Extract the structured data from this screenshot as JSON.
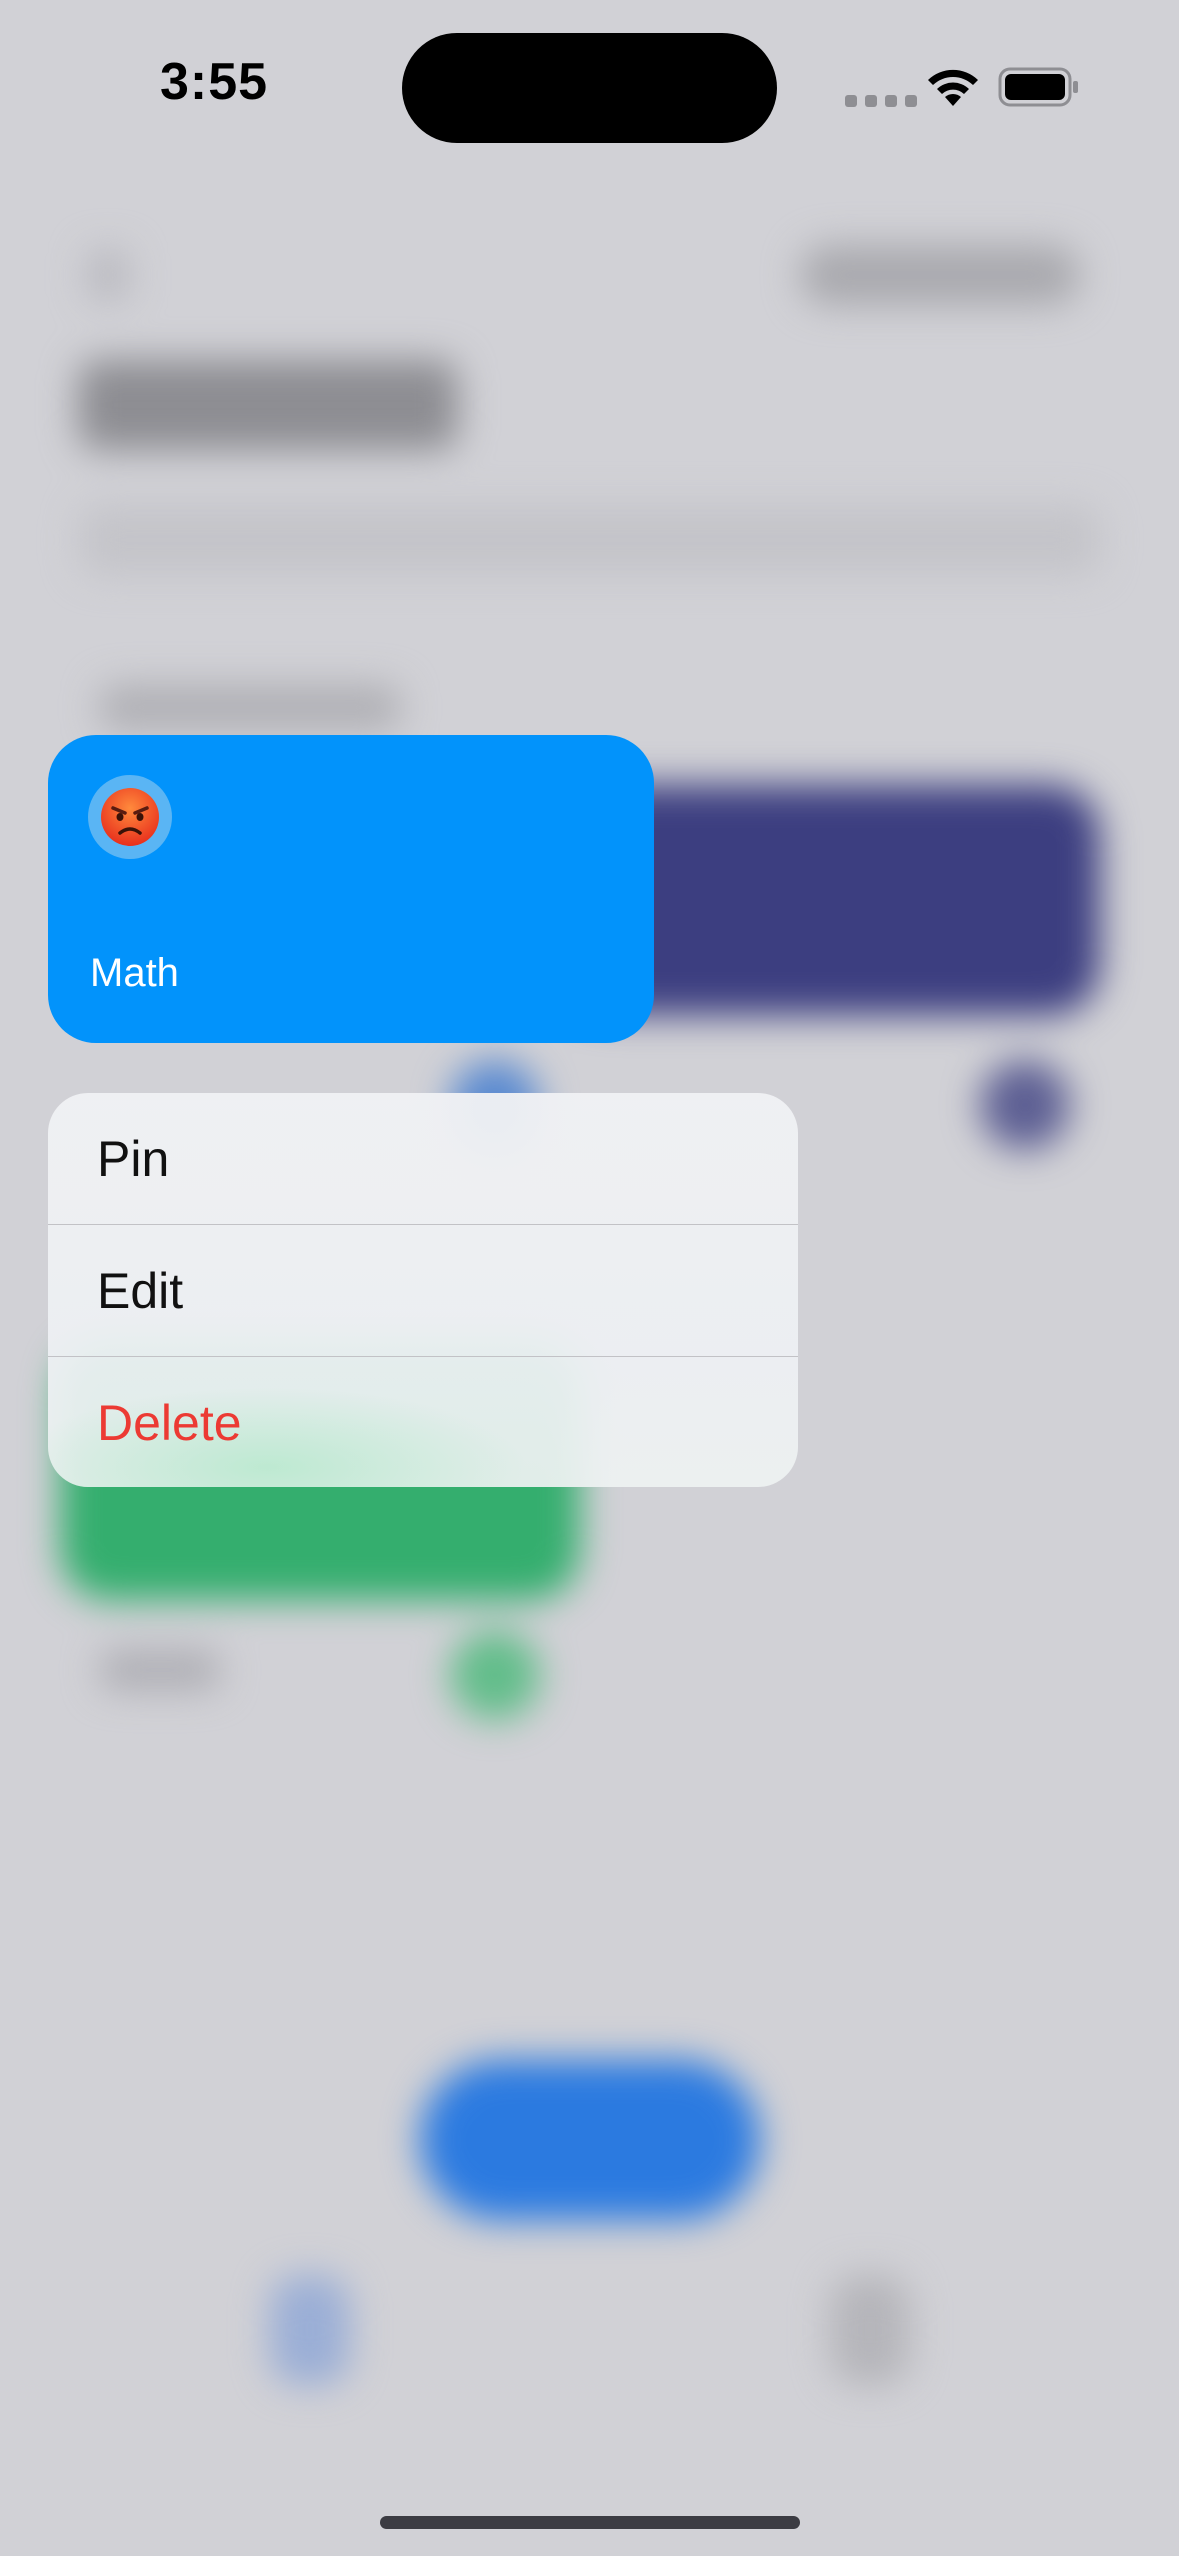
{
  "status_bar": {
    "time": "3:55"
  },
  "card": {
    "title": "Math",
    "emoji": "😡",
    "color": "#0293fb"
  },
  "context_menu": {
    "items": [
      {
        "label": "Pin"
      },
      {
        "label": "Edit"
      },
      {
        "label": "Delete",
        "destructive": true
      }
    ],
    "destructive_color": "#ec3a33"
  },
  "icons": {
    "wifi": "wifi-icon",
    "battery": "battery-icon",
    "signal": "signal-dots-icon"
  }
}
